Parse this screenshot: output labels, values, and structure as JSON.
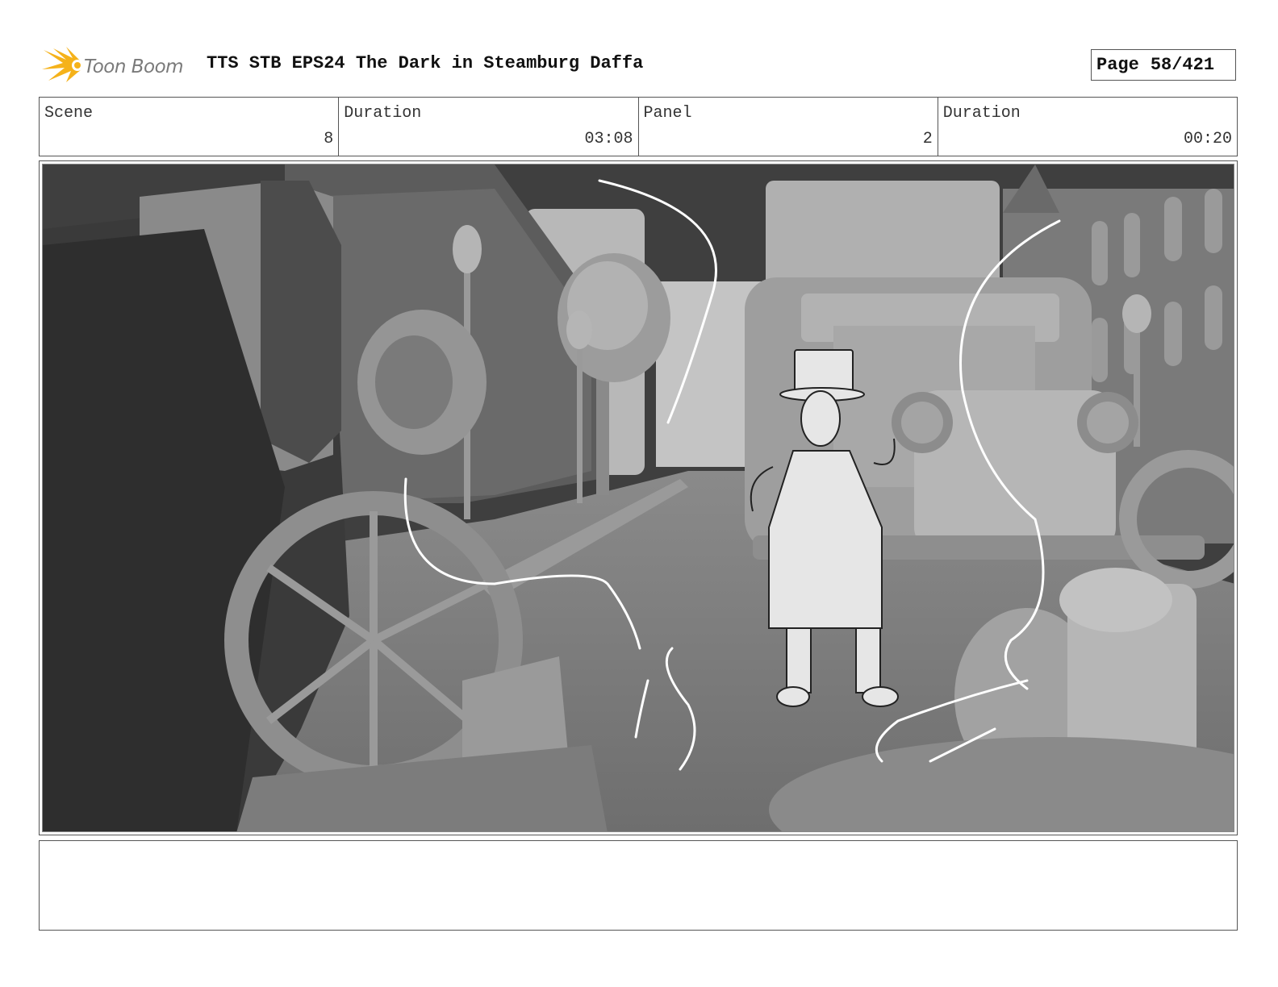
{
  "header": {
    "logo_text": "Toon Boom",
    "title": "TTS STB EPS24 The Dark in Steamburg Daffa",
    "page_label": "Page",
    "page_number": "58/421"
  },
  "info": {
    "scene_label": "Scene",
    "scene_value": "8",
    "scene_duration_label": "Duration",
    "scene_duration_value": "03:08",
    "panel_label": "Panel",
    "panel_value": "2",
    "panel_duration_label": "Duration",
    "panel_duration_value": "00:20"
  },
  "colors": {
    "logo_flame": "#f5b21a",
    "logo_text": "#7a7a7a",
    "frame_border": "#555555"
  },
  "icons": {
    "logo": "toon-boom-flame-icon"
  }
}
